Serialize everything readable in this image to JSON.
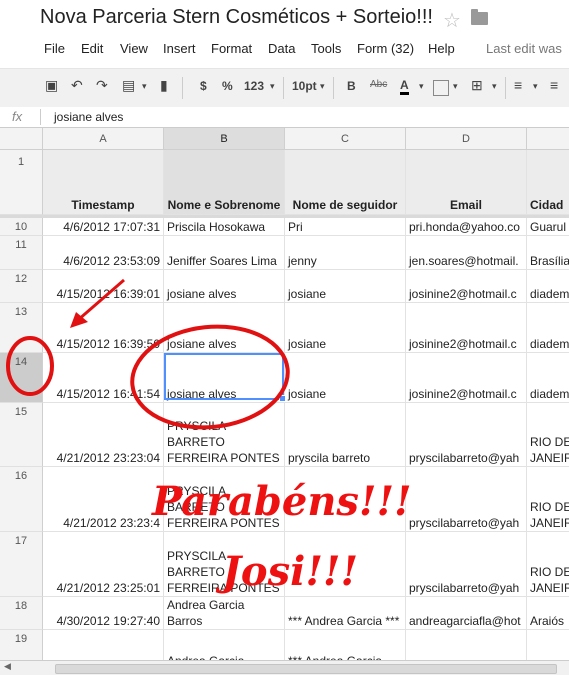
{
  "document": {
    "title": "Nova Parceria Stern Cosméticos + Sorteio!!!"
  },
  "menu": {
    "items": [
      "File",
      "Edit",
      "View",
      "Insert",
      "Format",
      "Data",
      "Tools",
      "Form (32)",
      "Help"
    ],
    "last_edit": "Last edit was"
  },
  "toolbar": {
    "currency": "$",
    "percent": "%",
    "number_format": "123",
    "font_size": "10pt",
    "bold": "B",
    "strike": "Abc",
    "text_color": "A"
  },
  "formula_bar": {
    "fx": "fx",
    "value": "josiane alves"
  },
  "columns": [
    "A",
    "B",
    "C",
    "D",
    ""
  ],
  "header_row": {
    "number": "1",
    "cells": [
      "Timestamp",
      "Nome e Sobrenome",
      "Nome de seguidor",
      "Email",
      "Cidad"
    ]
  },
  "rows": [
    {
      "number": "10",
      "cells": [
        "4/6/2012 17:07:31",
        "Priscila Hosokawa",
        "Pri",
        "pri.honda@yahoo.co",
        "Guarul"
      ]
    },
    {
      "number": "11",
      "cells": [
        "4/6/2012 23:53:09",
        "Jeniffer Soares Lima",
        "jenny",
        "jen.soares@hotmail.",
        "Brasília"
      ]
    },
    {
      "number": "12",
      "cells": [
        "4/15/2012 16:39:01",
        "josiane alves",
        "josiane",
        "josinine2@hotmail.c",
        "diadem"
      ]
    },
    {
      "number": "13",
      "cells": [
        "4/15/2012 16:39:50",
        "josiane alves",
        "josiane",
        "josinine2@hotmail.c",
        "diadem"
      ]
    },
    {
      "number": "14",
      "cells": [
        "4/15/2012 16:41:54",
        "josiane alves",
        "josiane",
        "josinine2@hotmail.c",
        "diadem"
      ]
    },
    {
      "number": "15",
      "cells": [
        "4/21/2012 23:23:04",
        "PRYSCILA BARRETO FERREIRA PONTES",
        "pryscila barreto",
        "pryscilabarreto@yah",
        "RIO DE JANEIR"
      ]
    },
    {
      "number": "16",
      "cells": [
        "4/21/2012 23:23:4",
        "PRYSCILA BARRETO FERREIRA PONTES",
        "",
        "pryscilabarreto@yah",
        "RIO DE JANEIR"
      ]
    },
    {
      "number": "17",
      "cells": [
        "4/21/2012 23:25:01",
        "PRYSCILA BARRETO FERREIRA PONTES",
        "",
        "pryscilabarreto@yah",
        "RIO DE JANEIR"
      ]
    },
    {
      "number": "18",
      "cells": [
        "4/30/2012 19:27:40",
        "Andrea Garcia Barros",
        "*** Andrea Garcia ***",
        "andreagarciafla@hot",
        "Araiós"
      ]
    },
    {
      "number": "19",
      "cells": [
        "",
        "Andrea Garcia",
        "*** Andrea Garcia",
        "",
        ""
      ]
    }
  ],
  "annotation": {
    "line1": "Parabéns!!!",
    "line2": "Josi!!!"
  },
  "colors": {
    "accent": "#4d90fe",
    "annotation": "#e11111"
  }
}
